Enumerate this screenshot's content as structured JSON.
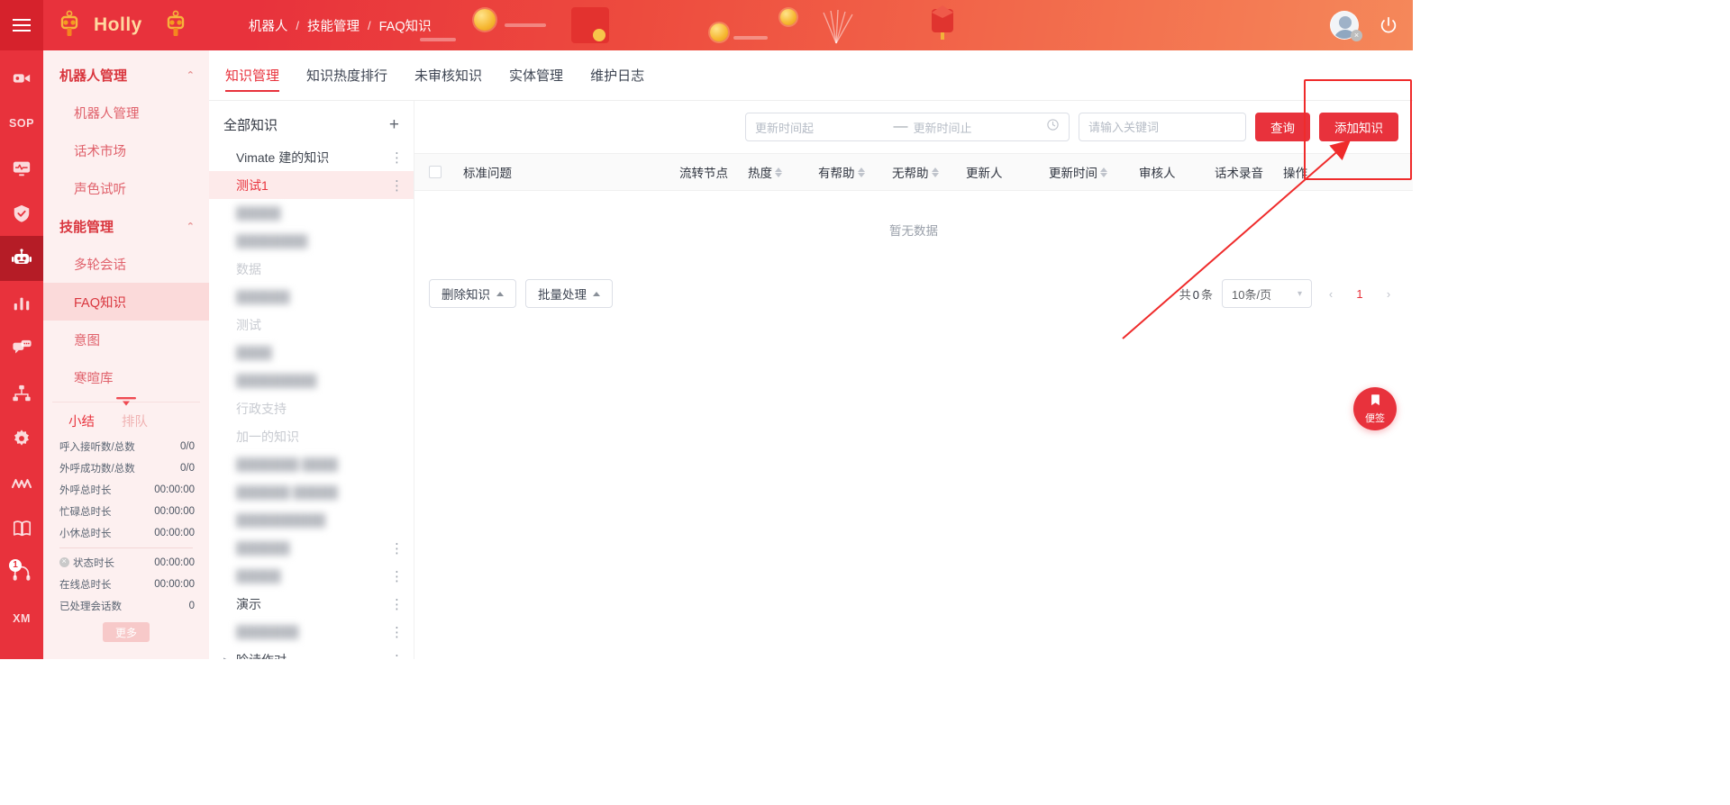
{
  "header": {
    "brand": "Holly",
    "breadcrumb": [
      "机器人",
      "技能管理",
      "FAQ知识"
    ],
    "separator": "/",
    "avatar_badge": "×",
    "accent": "#e8323c"
  },
  "rail": {
    "items": [
      {
        "name": "video-camera-icon",
        "label": ""
      },
      {
        "name": "sop-text",
        "label": "SOP"
      },
      {
        "name": "monitor-pulse-icon",
        "label": ""
      },
      {
        "name": "shield-check-icon",
        "label": ""
      },
      {
        "name": "robot-icon",
        "label": "",
        "active": true
      },
      {
        "name": "bar-chart-icon",
        "label": ""
      },
      {
        "name": "chat-bubbles-icon",
        "label": ""
      },
      {
        "name": "org-tree-icon",
        "label": ""
      },
      {
        "name": "gear-icon",
        "label": ""
      },
      {
        "name": "wave-icon",
        "label": ""
      },
      {
        "name": "book-icon",
        "label": ""
      },
      {
        "name": "headset-icon",
        "label": "",
        "badge": "1"
      },
      {
        "name": "xm-text",
        "label": "XM"
      }
    ]
  },
  "nav": {
    "groups": [
      {
        "title": "机器人管理",
        "items": [
          {
            "label": "机器人管理"
          },
          {
            "label": "话术市场"
          },
          {
            "label": "声色试听"
          }
        ]
      },
      {
        "title": "技能管理",
        "items": [
          {
            "label": "多轮会话"
          },
          {
            "label": "FAQ知识",
            "active": true
          },
          {
            "label": "意图"
          },
          {
            "label": "寒暄库"
          }
        ]
      }
    ],
    "stats": {
      "tabs": [
        {
          "label": "小结",
          "active": true
        },
        {
          "label": "排队",
          "active": false
        }
      ],
      "rows": [
        {
          "label": "呼入接听数/总数",
          "value": "0/0"
        },
        {
          "label": "外呼成功数/总数",
          "value": "0/0"
        },
        {
          "label": "外呼总时长",
          "value": "00:00:00"
        },
        {
          "label": "忙碌总时长",
          "value": "00:00:00"
        },
        {
          "label": "小休总时长",
          "value": "00:00:00"
        }
      ],
      "rows2": [
        {
          "label": "状态时长",
          "value": "00:00:00",
          "icon": "status-dot-icon"
        },
        {
          "label": "在线总时长",
          "value": "00:00:00"
        },
        {
          "label": "已处理会话数",
          "value": "0"
        }
      ],
      "more_label": "更多"
    }
  },
  "main": {
    "tabs": [
      {
        "label": "知识管理",
        "active": true
      },
      {
        "label": "知识热度排行",
        "active": false
      },
      {
        "label": "未审核知识",
        "active": false
      },
      {
        "label": "实体管理",
        "active": false
      },
      {
        "label": "维护日志",
        "active": false
      }
    ],
    "tree": {
      "title": "全部知识",
      "add_icon": "plus-icon",
      "nodes": [
        {
          "label": "Vimate 建的知识",
          "state": "normal",
          "dots": true
        },
        {
          "label": "测试1",
          "state": "selected",
          "dots": true
        },
        {
          "label": "█████",
          "state": "blurred"
        },
        {
          "label": "████████",
          "state": "blurred"
        },
        {
          "label": "数据",
          "state": "dim"
        },
        {
          "label": "██████",
          "state": "blurred"
        },
        {
          "label": "测试",
          "state": "dim"
        },
        {
          "label": "████",
          "state": "blurred"
        },
        {
          "label": "█████████",
          "state": "blurred"
        },
        {
          "label": "行政支持",
          "state": "dim"
        },
        {
          "label": "加一的知识",
          "state": "dim"
        },
        {
          "label": "███████  ████",
          "state": "blurred"
        },
        {
          "label": "██████   █████",
          "state": "blurred"
        },
        {
          "label": "██████████",
          "state": "blurred"
        },
        {
          "label": "██████",
          "state": "blurred",
          "dots": true
        },
        {
          "label": "█████",
          "state": "blurred",
          "dots": true
        },
        {
          "label": "演示",
          "state": "normal",
          "dots": true
        },
        {
          "label": "███████",
          "state": "blurred",
          "dots": true
        },
        {
          "label": "吟诗作对",
          "state": "normal",
          "dots": true,
          "caret": "▸"
        },
        {
          "label": "██████████████",
          "state": "blurred",
          "caret": "▸"
        }
      ]
    },
    "filters": {
      "date_start_placeholder": "更新时间起",
      "date_dash": "—",
      "date_end_placeholder": "更新时间止",
      "clock_icon": "clock-icon",
      "keyword_placeholder": "请输入关键词",
      "keyword_value": "",
      "query_label": "查询",
      "add_label": "添加知识"
    },
    "table": {
      "columns": [
        {
          "label": "标准问题",
          "sortable": false
        },
        {
          "label": "流转节点",
          "sortable": false
        },
        {
          "label": "热度",
          "sortable": true
        },
        {
          "label": "有帮助",
          "sortable": true
        },
        {
          "label": "无帮助",
          "sortable": true
        },
        {
          "label": "更新人",
          "sortable": false
        },
        {
          "label": "更新时间",
          "sortable": true
        },
        {
          "label": "审核人",
          "sortable": false
        },
        {
          "label": "话术录音",
          "sortable": false
        },
        {
          "label": "操作",
          "sortable": false
        }
      ],
      "empty_text": "暂无数据",
      "rows": []
    },
    "bottom": {
      "delete_label": "删除知识",
      "batch_label": "批量处理",
      "total_prefix": "共",
      "total_count": "0",
      "total_suffix": "条",
      "page_size": "10条/页",
      "prev": "‹",
      "page": "1",
      "next": "›"
    },
    "fab": {
      "label": "便签",
      "icon": "bookmark-icon"
    }
  },
  "annotation": {
    "highlight_target": "添加知识",
    "color": "#ef2b2b"
  }
}
